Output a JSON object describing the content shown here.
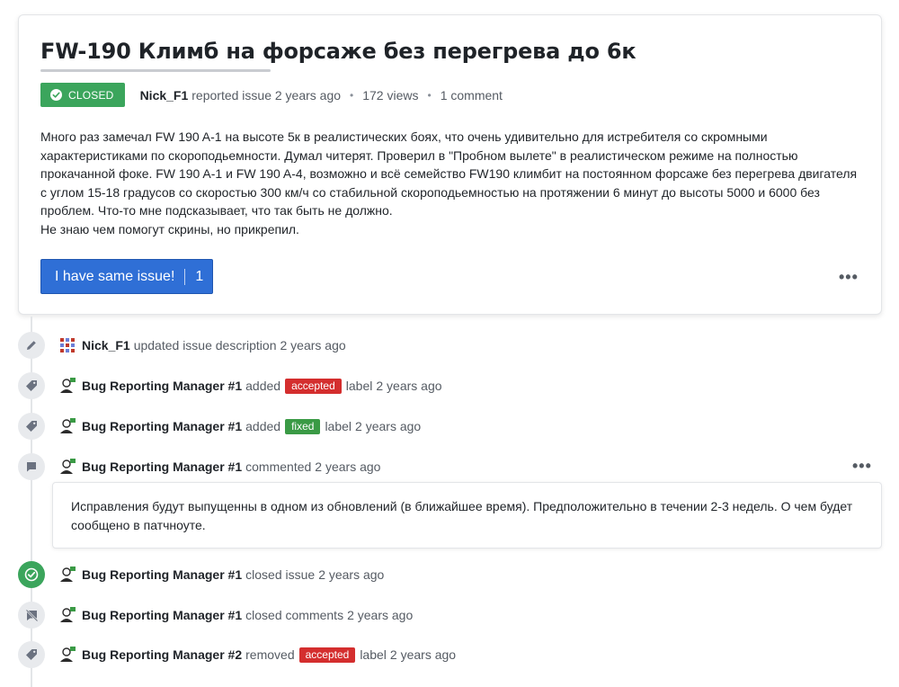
{
  "issue": {
    "title": "FW-190 Климб на форсаже без перегрева до 6к",
    "status": "CLOSED",
    "author": "Nick_F1",
    "reported_text": "reported issue 2 years ago",
    "views": "172 views",
    "comments": "1 comment",
    "body": [
      "Много раз замечал FW 190 A-1 на высоте 5к в реалистических боях, что очень удивительно для истребителя со скромными характеристиками по скороподьемности. Думал читерят. Проверил в \"Пробном вылете\" в реалистическом режиме на полностью прокачанной фоке. FW 190 A-1 и FW 190 A-4, возможно и всё семейство FW190 климбит на постоянном форсаже без перегрева двигателя с углом 15-18 градусов со скоростью 300 км/ч со стабильной скороподьемностью на протяжении 6 минут до высоты 5000 и 6000 без проблем. Что-то мне подсказывает, что так быть не должно.",
      "Не знаю чем помогут скрины, но прикрепил."
    ],
    "same_issue_label": "I have same issue!",
    "same_issue_count": "1"
  },
  "timeline": [
    {
      "icon": "pencil-icon",
      "actor": "Nick_F1",
      "text": "updated issue description",
      "time": "2 years ago"
    },
    {
      "icon": "tag-icon",
      "actor": "Bug Reporting Manager #1",
      "text": "added",
      "label": "accepted",
      "label_color": "#d42e2e",
      "after": "label",
      "time": "2 years ago"
    },
    {
      "icon": "tag-icon",
      "actor": "Bug Reporting Manager #1",
      "text": "added",
      "label": "fixed",
      "label_color": "#3a9a45",
      "after": "label",
      "time": "2 years ago"
    },
    {
      "icon": "comment-icon",
      "actor": "Bug Reporting Manager #1",
      "text": "commented",
      "time": "2 years ago"
    },
    {
      "icon": "check-circle-icon",
      "actor": "Bug Reporting Manager #1",
      "text": "closed issue",
      "time": "2 years ago"
    },
    {
      "icon": "comment-closed-icon",
      "actor": "Bug Reporting Manager #1",
      "text": "closed comments",
      "time": "2 years ago"
    },
    {
      "icon": "tag-icon",
      "actor": "Bug Reporting Manager #2",
      "text": "removed",
      "label": "accepted",
      "label_color": "#d42e2e",
      "after": "label",
      "time": "2 years ago"
    }
  ],
  "comment": {
    "text": "Исправления будут выпущенны в одном из обновлений (в ближайшее время). Предположительно в течении 2-3 недель. О чем будет сообщено в патчноуте."
  },
  "colors": {
    "closed_badge": "#3ba55c",
    "primary_button": "#2f6fd6",
    "label_accepted": "#d42e2e",
    "label_fixed": "#3a9a45"
  }
}
